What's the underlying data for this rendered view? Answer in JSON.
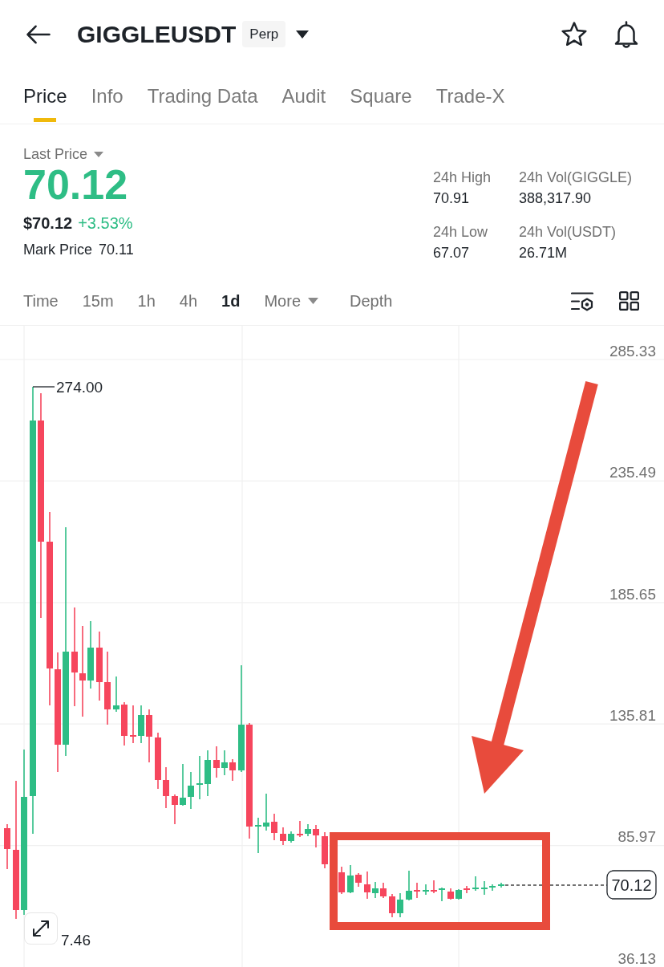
{
  "header": {
    "title": "GIGGLEUSDT",
    "badge": "Perp"
  },
  "tabs": [
    {
      "label": "Price",
      "selected": true
    },
    {
      "label": "Info",
      "selected": false
    },
    {
      "label": "Trading Data",
      "selected": false
    },
    {
      "label": "Audit",
      "selected": false
    },
    {
      "label": "Square",
      "selected": false
    },
    {
      "label": "Trade-X",
      "selected": false
    }
  ],
  "ticker": {
    "last_price_label": "Last Price",
    "last_price": "70.12",
    "usd_price": "$70.12",
    "change": "+3.53%",
    "mark_price_label": "Mark Price",
    "mark_price": "70.11"
  },
  "stats": [
    {
      "label": "24h High",
      "value": "70.91"
    },
    {
      "label": "24h Vol(GIGGLE)",
      "value": "388,317.90"
    },
    {
      "label": "24h Low",
      "value": "67.07"
    },
    {
      "label": "24h Vol(USDT)",
      "value": "26.71M"
    }
  ],
  "intervals": [
    {
      "label": "Time",
      "kind": "option",
      "selected": false
    },
    {
      "label": "15m",
      "kind": "option",
      "selected": false
    },
    {
      "label": "1h",
      "kind": "option",
      "selected": false
    },
    {
      "label": "4h",
      "kind": "option",
      "selected": false
    },
    {
      "label": "1d",
      "kind": "option",
      "selected": true
    },
    {
      "label": "More",
      "kind": "dropdown",
      "selected": false
    },
    {
      "label": "Depth",
      "kind": "option",
      "selected": false
    }
  ],
  "chart": {
    "price_axis": [
      "285.33",
      "235.49",
      "185.65",
      "135.81",
      "85.97",
      "36.13"
    ],
    "high_marker": "274.00",
    "low_marker": "7.46",
    "current_price": "70.12"
  }
}
